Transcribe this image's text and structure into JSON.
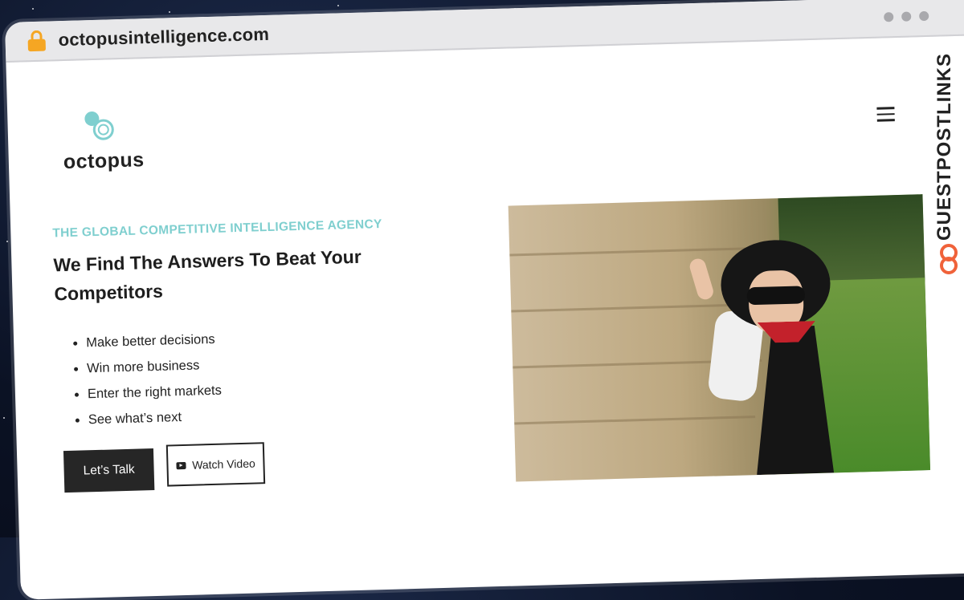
{
  "browser": {
    "url": "octopusintelligence.com"
  },
  "site": {
    "logo_text": "octopus",
    "eyebrow": "THE GLOBAL COMPETITIVE INTELLIGENCE AGENCY",
    "headline": "We Find The Answers To Beat Your Competitors",
    "bullets": [
      "Make better decisions",
      "Win more business",
      "Enter the right markets",
      "See what’s next"
    ],
    "cta_primary": "Let’s Talk",
    "cta_secondary": "Watch Video"
  },
  "watermark": {
    "text": "GUESTPOSTLINKS"
  },
  "colors": {
    "accent": "#7fcfcf",
    "button_dark": "#262626",
    "watermark_icon": "#f0623a",
    "lock": "#f5a623"
  }
}
